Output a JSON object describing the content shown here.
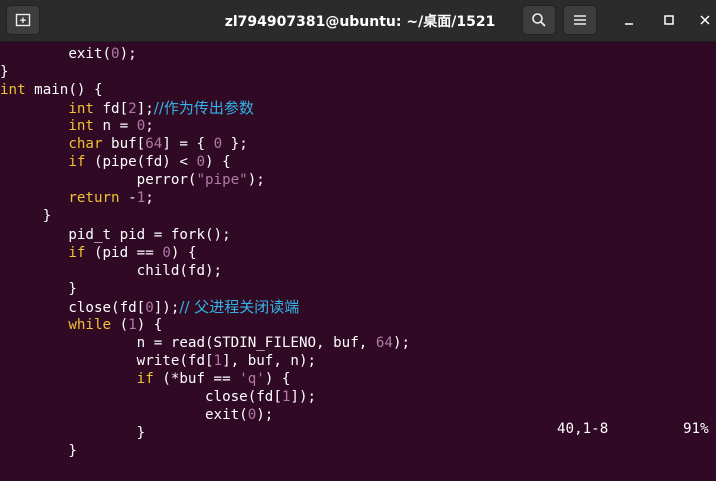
{
  "window": {
    "title": "zl794907381@ubuntu: ~/桌面/1521",
    "buttons": [
      "new-tab",
      "search",
      "menu",
      "minimize",
      "maximize",
      "close"
    ]
  },
  "editor": {
    "lines": [
      [
        {
          "t": "        exit("
        },
        {
          "t": "0",
          "c": "num"
        },
        {
          "t": ");"
        }
      ],
      [
        {
          "t": "}"
        }
      ],
      [
        {
          "t": "int",
          "c": "kw"
        },
        {
          "t": " main() {"
        }
      ],
      [
        {
          "t": "        "
        },
        {
          "t": "int",
          "c": "kw"
        },
        {
          "t": " fd["
        },
        {
          "t": "2",
          "c": "num"
        },
        {
          "t": "];"
        },
        {
          "t": "//作为传出参数",
          "c": "cmt"
        }
      ],
      [
        {
          "t": "        "
        },
        {
          "t": "int",
          "c": "kw"
        },
        {
          "t": " n = "
        },
        {
          "t": "0",
          "c": "num"
        },
        {
          "t": ";"
        }
      ],
      [
        {
          "t": "        "
        },
        {
          "t": "char",
          "c": "kw"
        },
        {
          "t": " buf["
        },
        {
          "t": "64",
          "c": "num"
        },
        {
          "t": "] = { "
        },
        {
          "t": "0",
          "c": "num"
        },
        {
          "t": " };"
        }
      ],
      [
        {
          "t": "        "
        },
        {
          "t": "if",
          "c": "kw"
        },
        {
          "t": " (pipe(fd) < "
        },
        {
          "t": "0",
          "c": "num"
        },
        {
          "t": ") {"
        }
      ],
      [
        {
          "t": "                perror("
        },
        {
          "t": "\"pipe\"",
          "c": "str"
        },
        {
          "t": ");"
        }
      ],
      [
        {
          "t": "        "
        },
        {
          "t": "return",
          "c": "kw"
        },
        {
          "t": " -"
        },
        {
          "t": "1",
          "c": "num"
        },
        {
          "t": ";"
        }
      ],
      [
        {
          "t": "     }"
        }
      ],
      [
        {
          "t": "        pid_t pid = fork();"
        }
      ],
      [
        {
          "t": "        "
        },
        {
          "t": "if",
          "c": "kw"
        },
        {
          "t": " (pid == "
        },
        {
          "t": "0",
          "c": "num"
        },
        {
          "t": ") {"
        }
      ],
      [
        {
          "t": "                child(fd);"
        }
      ],
      [
        {
          "t": "        }"
        }
      ],
      [
        {
          "t": "        close(fd["
        },
        {
          "t": "0",
          "c": "num"
        },
        {
          "t": "]);"
        },
        {
          "t": "// 父进程关闭读端",
          "c": "cmt"
        }
      ],
      [
        {
          "t": "        "
        },
        {
          "t": "while",
          "c": "kw"
        },
        {
          "t": " ("
        },
        {
          "t": "1",
          "c": "num"
        },
        {
          "t": ") {"
        }
      ],
      [
        {
          "t": "                n = read(STDIN_FILENO, buf, "
        },
        {
          "t": "64",
          "c": "num"
        },
        {
          "t": ");"
        }
      ],
      [
        {
          "t": "                write(fd["
        },
        {
          "t": "1",
          "c": "num"
        },
        {
          "t": "], buf, n);"
        }
      ],
      [
        {
          "t": "                "
        },
        {
          "t": "if",
          "c": "kw"
        },
        {
          "t": " (*buf == "
        },
        {
          "t": "'q'",
          "c": "str"
        },
        {
          "t": ") {"
        }
      ],
      [
        {
          "t": "                        close(fd["
        },
        {
          "t": "1",
          "c": "num"
        },
        {
          "t": "]);"
        }
      ],
      [
        {
          "t": "                        exit("
        },
        {
          "t": "0",
          "c": "num"
        },
        {
          "t": ");"
        }
      ],
      [
        {
          "t": "                }"
        }
      ],
      [
        {
          "t": "        }"
        }
      ]
    ]
  },
  "status": {
    "position": "40,1-8",
    "percent": "91%"
  },
  "colors": {
    "background": "#300a24",
    "keyword": "#f1c232",
    "number": "#b07aa5",
    "comment": "#35b3e6",
    "text": "#ffffff"
  }
}
